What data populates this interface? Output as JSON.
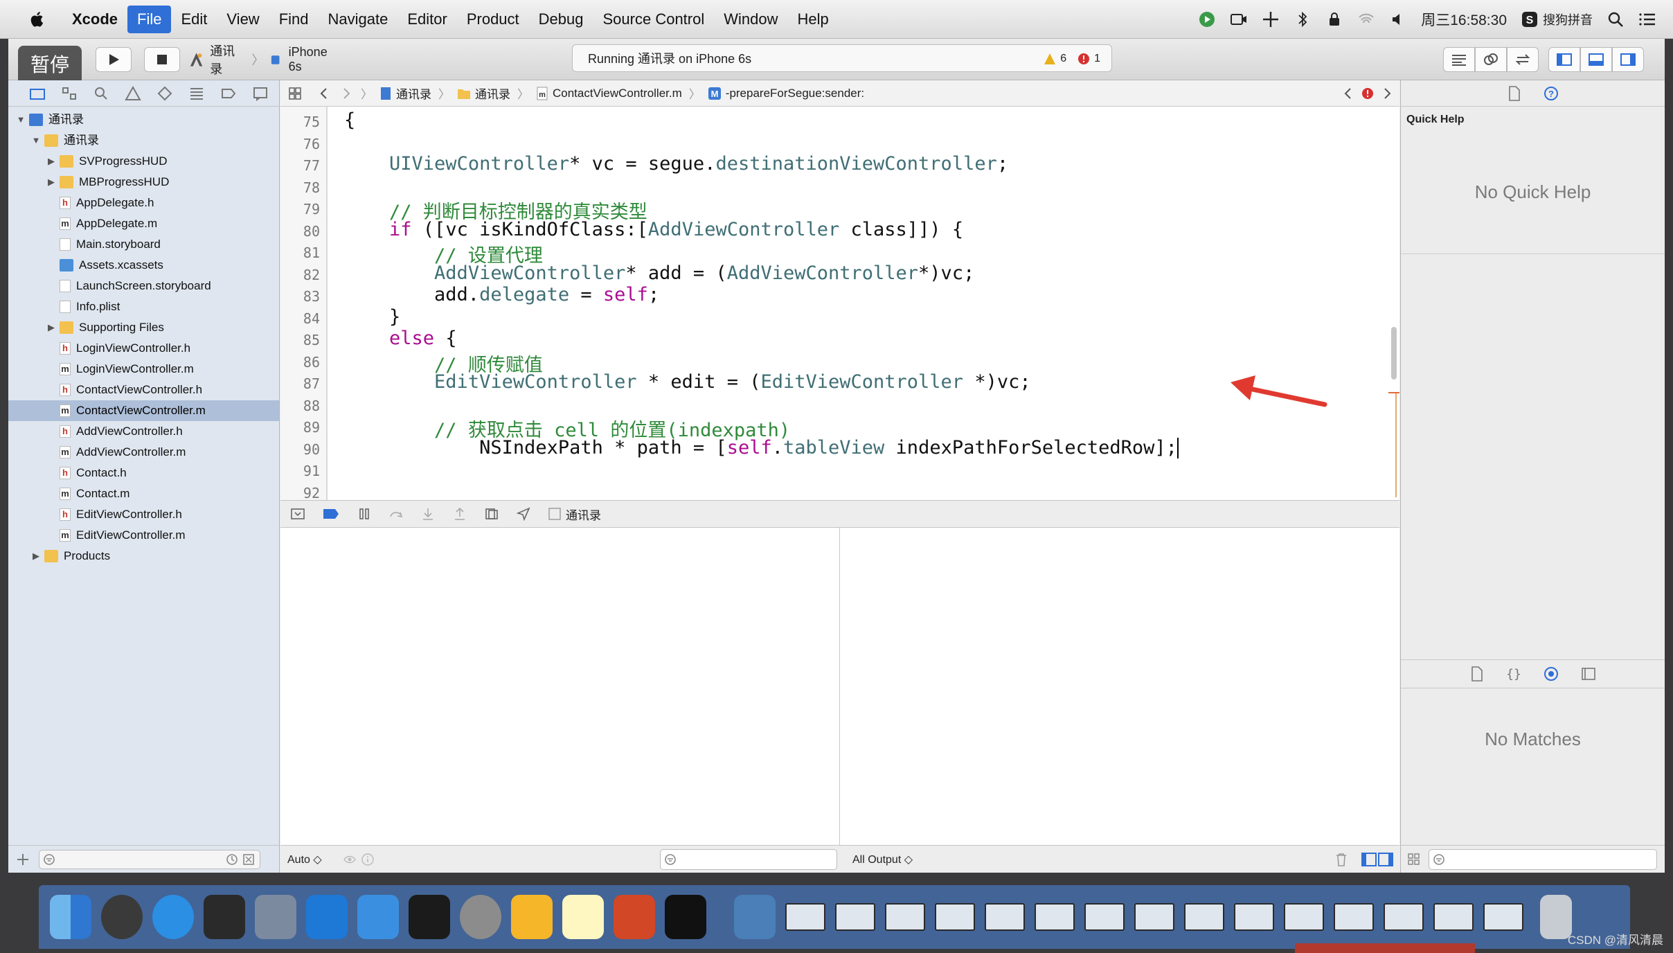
{
  "menubar": {
    "items": [
      "Xcode",
      "File",
      "Edit",
      "View",
      "Find",
      "Navigate",
      "Editor",
      "Product",
      "Debug",
      "Source Control",
      "Window",
      "Help"
    ],
    "active": "File",
    "clock": "周三16:58:30",
    "ime": "搜狗拼音"
  },
  "toolbar": {
    "pause_badge": "暂停",
    "scheme_name": "通讯录",
    "device": "iPhone 6s",
    "activity": "Running 通讯录 on iPhone 6s",
    "warnings": "6",
    "errors": "1"
  },
  "navigator": {
    "items": [
      {
        "label": "通讯录",
        "icon": "project",
        "indent": 0,
        "open": true
      },
      {
        "label": "通讯录",
        "icon": "folder",
        "indent": 1,
        "open": true
      },
      {
        "label": "SVProgressHUD",
        "icon": "folder",
        "indent": 2,
        "closed": true
      },
      {
        "label": "MBProgressHUD",
        "icon": "folder",
        "indent": 2,
        "closed": true
      },
      {
        "label": "AppDelegate.h",
        "icon": "h",
        "indent": 2
      },
      {
        "label": "AppDelegate.m",
        "icon": "m",
        "indent": 2
      },
      {
        "label": "Main.storyboard",
        "icon": "other",
        "indent": 2
      },
      {
        "label": "Assets.xcassets",
        "icon": "assets",
        "indent": 2
      },
      {
        "label": "LaunchScreen.storyboard",
        "icon": "other",
        "indent": 2
      },
      {
        "label": "Info.plist",
        "icon": "other",
        "indent": 2
      },
      {
        "label": "Supporting Files",
        "icon": "folder",
        "indent": 2,
        "closed": true
      },
      {
        "label": "LoginViewController.h",
        "icon": "h",
        "indent": 2
      },
      {
        "label": "LoginViewController.m",
        "icon": "m",
        "indent": 2
      },
      {
        "label": "ContactViewController.h",
        "icon": "h",
        "indent": 2
      },
      {
        "label": "ContactViewController.m",
        "icon": "m",
        "indent": 2,
        "selected": true
      },
      {
        "label": "AddViewController.h",
        "icon": "h",
        "indent": 2
      },
      {
        "label": "AddViewController.m",
        "icon": "m",
        "indent": 2
      },
      {
        "label": "Contact.h",
        "icon": "h",
        "indent": 2
      },
      {
        "label": "Contact.m",
        "icon": "m",
        "indent": 2
      },
      {
        "label": "EditViewController.h",
        "icon": "h",
        "indent": 2
      },
      {
        "label": "EditViewController.m",
        "icon": "m",
        "indent": 2
      },
      {
        "label": "Products",
        "icon": "folder",
        "indent": 1,
        "closed": true
      }
    ]
  },
  "jumpbar": {
    "crumbs": [
      "通讯录",
      "通讯录",
      "ContactViewController.m",
      "-prepareForSegue:sender:"
    ]
  },
  "code": {
    "line_numbers": [
      "75",
      "76",
      "77",
      "78",
      "79",
      "80",
      "81",
      "82",
      "83",
      "84",
      "85",
      "86",
      "87",
      "88",
      "89",
      "90",
      "91",
      "92"
    ],
    "lines": [
      [
        [
          "p",
          "{"
        ]
      ],
      [],
      [
        [
          "p",
          "    "
        ],
        [
          "cls",
          "UIViewController"
        ],
        [
          "p",
          "* vc = segue."
        ],
        [
          "prop",
          "destinationViewController"
        ],
        [
          "p",
          ";"
        ]
      ],
      [],
      [
        [
          "p",
          "    "
        ],
        [
          "cm",
          "// 判断目标控制器的真实类型"
        ]
      ],
      [
        [
          "p",
          "    "
        ],
        [
          "kw",
          "if"
        ],
        [
          "p",
          " ([vc isKindOfClass:["
        ],
        [
          "cls",
          "AddViewController"
        ],
        [
          "p",
          " class]]) {"
        ]
      ],
      [
        [
          "p",
          "        "
        ],
        [
          "cm",
          "// 设置代理"
        ]
      ],
      [
        [
          "p",
          "        "
        ],
        [
          "cls",
          "AddViewController"
        ],
        [
          "p",
          "* add = ("
        ],
        [
          "cls",
          "AddViewController"
        ],
        [
          "p",
          "*)vc;"
        ]
      ],
      [
        [
          "p",
          "        add."
        ],
        [
          "prop",
          "delegate"
        ],
        [
          "p",
          " = "
        ],
        [
          "kw",
          "self"
        ],
        [
          "p",
          ";"
        ]
      ],
      [
        [
          "p",
          "    }"
        ]
      ],
      [
        [
          "p",
          "    "
        ],
        [
          "kw",
          "else"
        ],
        [
          "p",
          " {"
        ]
      ],
      [
        [
          "p",
          "        "
        ],
        [
          "cm",
          "// 顺传赋值"
        ]
      ],
      [
        [
          "p",
          "        "
        ],
        [
          "cls",
          "EditViewController"
        ],
        [
          "p",
          " * edit = ("
        ],
        [
          "cls",
          "EditViewController"
        ],
        [
          "p",
          " *)vc;"
        ]
      ],
      [],
      [
        [
          "p",
          "        "
        ],
        [
          "cm",
          "// 获取点击 cell 的位置(indexpath)"
        ]
      ],
      [
        [
          "p",
          "            NSIndexPath * path = ["
        ],
        [
          "kw",
          "self"
        ],
        [
          "p",
          "."
        ],
        [
          "prop",
          "tableView"
        ],
        [
          "p",
          " indexPathForSelectedRow];"
        ]
      ],
      [],
      []
    ]
  },
  "debug": {
    "target": "通讯录",
    "auto_label": "Auto ◇",
    "output_label": "All Output ◇"
  },
  "inspector": {
    "title": "Quick Help",
    "no_quick_help": "No Quick Help",
    "no_matches": "No Matches"
  },
  "watermark": "CSDN @清风清晨"
}
